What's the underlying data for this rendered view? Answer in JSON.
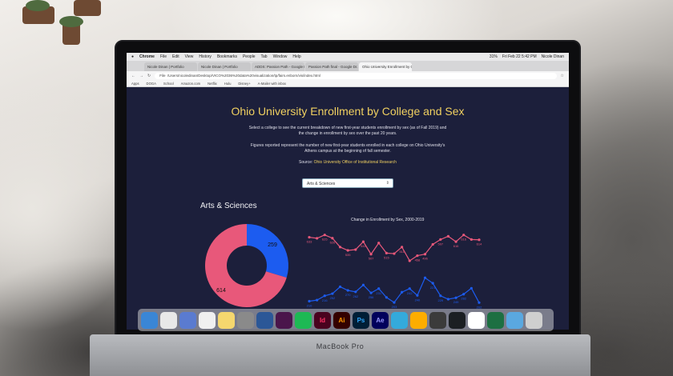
{
  "menubar": {
    "apple": "",
    "app": "Chrome",
    "items": [
      "File",
      "Edit",
      "View",
      "History",
      "Bookmarks",
      "People",
      "Tab",
      "Window",
      "Help"
    ],
    "clock": "Fri Feb 22 5:42 PM",
    "user": "Nicole Dinan",
    "battery": "31%"
  },
  "tabs": [
    {
      "label": "Nicole Dinan | Portfolio",
      "active": false
    },
    {
      "label": "Nicole Dinan | Portfolio",
      "active": false
    },
    {
      "label": "ADDS: Passion Path - Google D...",
      "active": false
    },
    {
      "label": "Passion Path final - Google Dr...",
      "active": false
    },
    {
      "label": "Ohio University Enrollment by C...",
      "active": true
    }
  ],
  "address": {
    "prefix": "File",
    "url": "/Users/nicoledinan/Desktop/VICO%2036%20data%20visualization/tp/fairs.enborn/vis/index.html"
  },
  "bookmarks": [
    "Apps",
    "DOGA",
    "School",
    "Amazon.com",
    "Netflix",
    "Hulu",
    "Disney+",
    "A-Mailer with inbox"
  ],
  "page": {
    "title": "Ohio University Enrollment by College and Sex",
    "desc1": "Select a college to see the current breakdown of new first-year students enrollment by sex (as of Fall 2019) and the change in enrollment by sex over the past 20 years.",
    "desc2": "Figures reported represent the number of new first-year students enrolled in each college on Ohio University's Athens campus at the beginning of fall semester.",
    "source_label": "Source:",
    "source_link": "Ohio University Office of Institutional Research",
    "select_value": "Arts & Sciences",
    "college_title": "Arts & Sciences",
    "line_title": "Change in Enrollment by Sex, 2000-2019"
  },
  "colors": {
    "female": "#e8587a",
    "male": "#1c5cf0",
    "background": "#1c1f3b",
    "accent": "#f0d060"
  },
  "donut": {
    "female": 614,
    "male": 259
  },
  "line_chart": {
    "female_labels": [
      "633",
      "625",
      "626",
      "535",
      "541",
      "507",
      "515",
      "511",
      "458",
      "496",
      "507",
      "616",
      "616",
      "614"
    ],
    "male_labels": [
      "210",
      "216",
      "252",
      "270",
      "262",
      "256",
      "231",
      "203",
      "242",
      "240",
      "221",
      "229",
      "249",
      "282",
      "202"
    ],
    "female_trend": [
      633,
      625,
      650,
      626,
      560,
      535,
      541,
      600,
      507,
      590,
      515,
      511,
      560,
      458,
      496,
      507,
      580,
      616,
      640,
      600,
      650,
      616,
      614
    ],
    "male_trend": [
      210,
      216,
      240,
      252,
      290,
      270,
      262,
      300,
      256,
      280,
      231,
      203,
      260,
      280,
      242,
      340,
      310,
      240,
      221,
      229,
      249,
      282,
      202
    ]
  },
  "dock": [
    "Finder",
    "Chrome",
    "Preview",
    "Calendar",
    "Notes",
    "System Preferences",
    "Word",
    "Slack",
    "Spotify",
    "Id",
    "Ai",
    "Ps",
    "Ae",
    "Messages",
    "Sketch",
    "Calculator",
    "GitHub",
    "Notion",
    "Excel",
    "Folder",
    "Trash"
  ],
  "laptop_brand": "MacBook Pro"
}
